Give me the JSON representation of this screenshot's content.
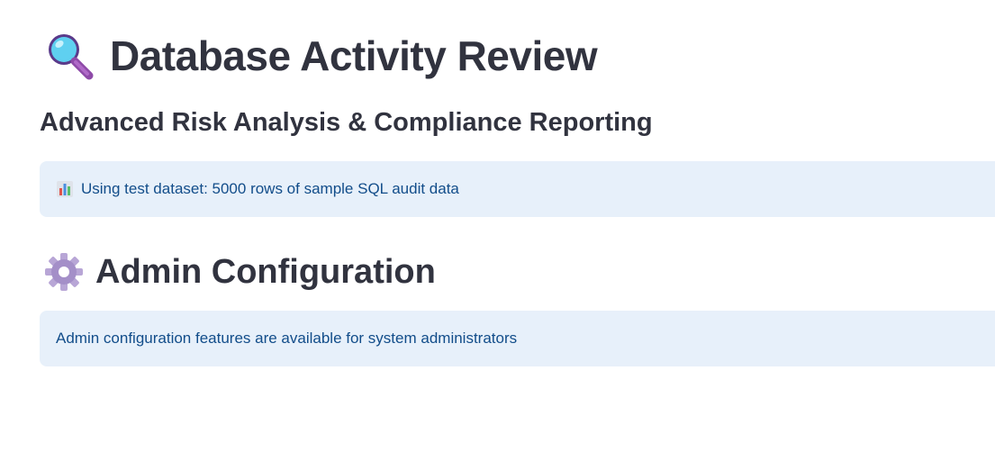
{
  "header": {
    "title": "Database Activity Review",
    "title_icon": "magnifying-glass-icon",
    "subtitle": "Advanced Risk Analysis & Compliance Reporting"
  },
  "dataset_notice": {
    "icon": "bar-chart-icon",
    "text": "Using test dataset: 5000 rows of sample SQL audit data"
  },
  "admin_section": {
    "icon": "gear-icon",
    "title": "Admin Configuration",
    "notice": "Admin configuration features are available for system administrators"
  },
  "colors": {
    "text": "#31333f",
    "info_bg": "#e7f0fa",
    "info_text": "#124d8a"
  }
}
